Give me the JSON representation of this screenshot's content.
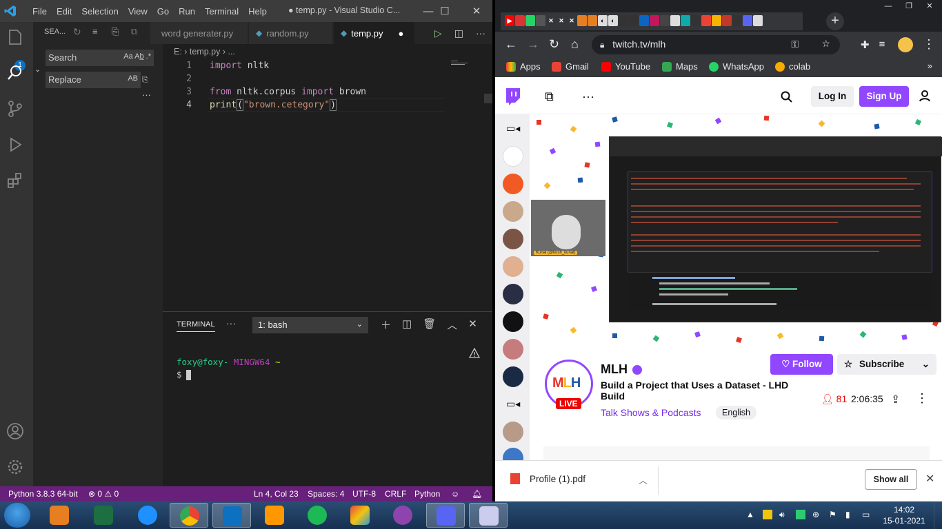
{
  "vscode": {
    "menu": [
      "File",
      "Edit",
      "Selection",
      "View",
      "Go",
      "Run",
      "Terminal",
      "Help"
    ],
    "window_title": "● temp.py - Visual Studio C...",
    "activity_badge": "1",
    "sidebar": {
      "header": "SEA...",
      "search_placeholder": "Search",
      "search_opts": "Aa Ab̲ .*",
      "replace_placeholder": "Replace",
      "replace_opts": "AB"
    },
    "tabs": [
      {
        "label": "word generater.py"
      },
      {
        "label": "random.py"
      },
      {
        "label": "temp.py",
        "dirty": "●"
      }
    ],
    "breadcrumb": "E: › temp.py › ...",
    "code_lines": [
      "1",
      "2",
      "3",
      "4"
    ],
    "panel": {
      "tab": "TERMINAL",
      "more": "···",
      "shell": "1: bash",
      "prompt_user": "foxy@foxy-",
      "prompt_host": "MINGW64",
      "prompt_dir": "~",
      "prompt_symbol": "$"
    },
    "status": {
      "python": "Python 3.8.3 64-bit",
      "problems": "⊗ 0 ⚠ 0",
      "position": "Ln 4, Col 23",
      "spaces": "Spaces: 4",
      "encoding": "UTF-8",
      "eol": "CRLF",
      "language": "Python"
    }
  },
  "chrome": {
    "url": "twitch.tv/mlh",
    "bookmarks": [
      "Apps",
      "Gmail",
      "YouTube",
      "Maps",
      "WhatsApp",
      "colab"
    ],
    "twitch": {
      "login": "Log In",
      "signup": "Sign Up",
      "channel_name": "MLH",
      "avatar_text": "MLH",
      "live": "LIVE",
      "stream_title": "Build a Project that Uses a Dataset - LHD Build",
      "category": "Talk Shows & Podcasts",
      "tag": "English",
      "follow": "Follow",
      "subscribe": "Subscribe",
      "viewers": "81",
      "uptime": "2:06:35",
      "webcam_label": "Kunal (@kush_kunal)"
    },
    "download": {
      "file": "Profile (1).pdf",
      "show_all": "Show all"
    }
  },
  "taskbar": {
    "time": "14:02",
    "date": "15-01-2021"
  },
  "colors": {
    "vscode_status": "#68217a",
    "twitch_purple": "#9147ff",
    "live_red": "#eb0400"
  }
}
